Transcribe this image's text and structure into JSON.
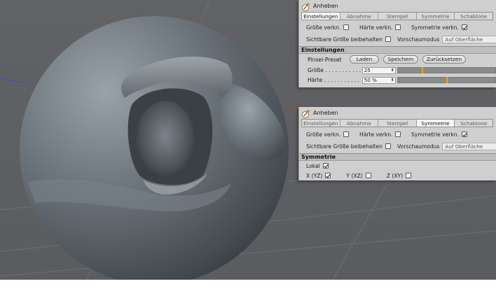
{
  "panel1": {
    "title": "Anheben",
    "tabs": [
      {
        "label": "Einstellungen",
        "active": true
      },
      {
        "label": "Abnahme",
        "active": false
      },
      {
        "label": "Stempel",
        "active": false
      },
      {
        "label": "Symmetrie",
        "active": false
      },
      {
        "label": "Schablone",
        "active": false
      }
    ],
    "opt_size": "Größe verkn.",
    "opt_size_checked": false,
    "opt_hardness": "Härte verkn.",
    "opt_hardness_checked": false,
    "opt_symmetry": "Symmetrie verkn.",
    "opt_symmetry_checked": true,
    "opt_visible_size": "Sichtbare Größe beibehalten",
    "opt_visible_size_checked": false,
    "preview_label": "Vorschaumodus",
    "preview_value": "Auf Oberfläche",
    "section": "Einstellungen",
    "preset_label": "Pinsel-Preset",
    "btn_load": "Laden",
    "btn_save": "Speichern",
    "btn_reset": "Zurücksetzen",
    "size_label": "Größe . . . . . . . . . . .",
    "size_value": "25",
    "size_slider": 0.25,
    "hardness_label": "Härte . . . . . . . . . . .",
    "hardness_value": "50 %",
    "hardness_slider": 0.5
  },
  "panel2": {
    "title": "Anheben",
    "tabs": [
      {
        "label": "Einstellungen",
        "active": false
      },
      {
        "label": "Abnahme",
        "active": false
      },
      {
        "label": "Stempel",
        "active": false
      },
      {
        "label": "Symmetrie",
        "active": true
      },
      {
        "label": "Schablone",
        "active": false
      }
    ],
    "opt_size": "Größe verkn.",
    "opt_size_checked": false,
    "opt_hardness": "Härte verkn.",
    "opt_hardness_checked": false,
    "opt_symmetry": "Symmetrie verkn.",
    "opt_symmetry_checked": true,
    "opt_visible_size": "Sichtbare Größe beibehalten",
    "opt_visible_size_checked": false,
    "preview_label": "Vorschaumodus",
    "preview_value": "Auf Oberfläche",
    "section": "Symmetrie",
    "local_label": "Lokal",
    "local_checked": true,
    "x_label": "X (YZ)",
    "x_checked": true,
    "y_label": "Y (XZ)",
    "y_checked": false,
    "z_label": "Z (XY)",
    "z_checked": false
  }
}
